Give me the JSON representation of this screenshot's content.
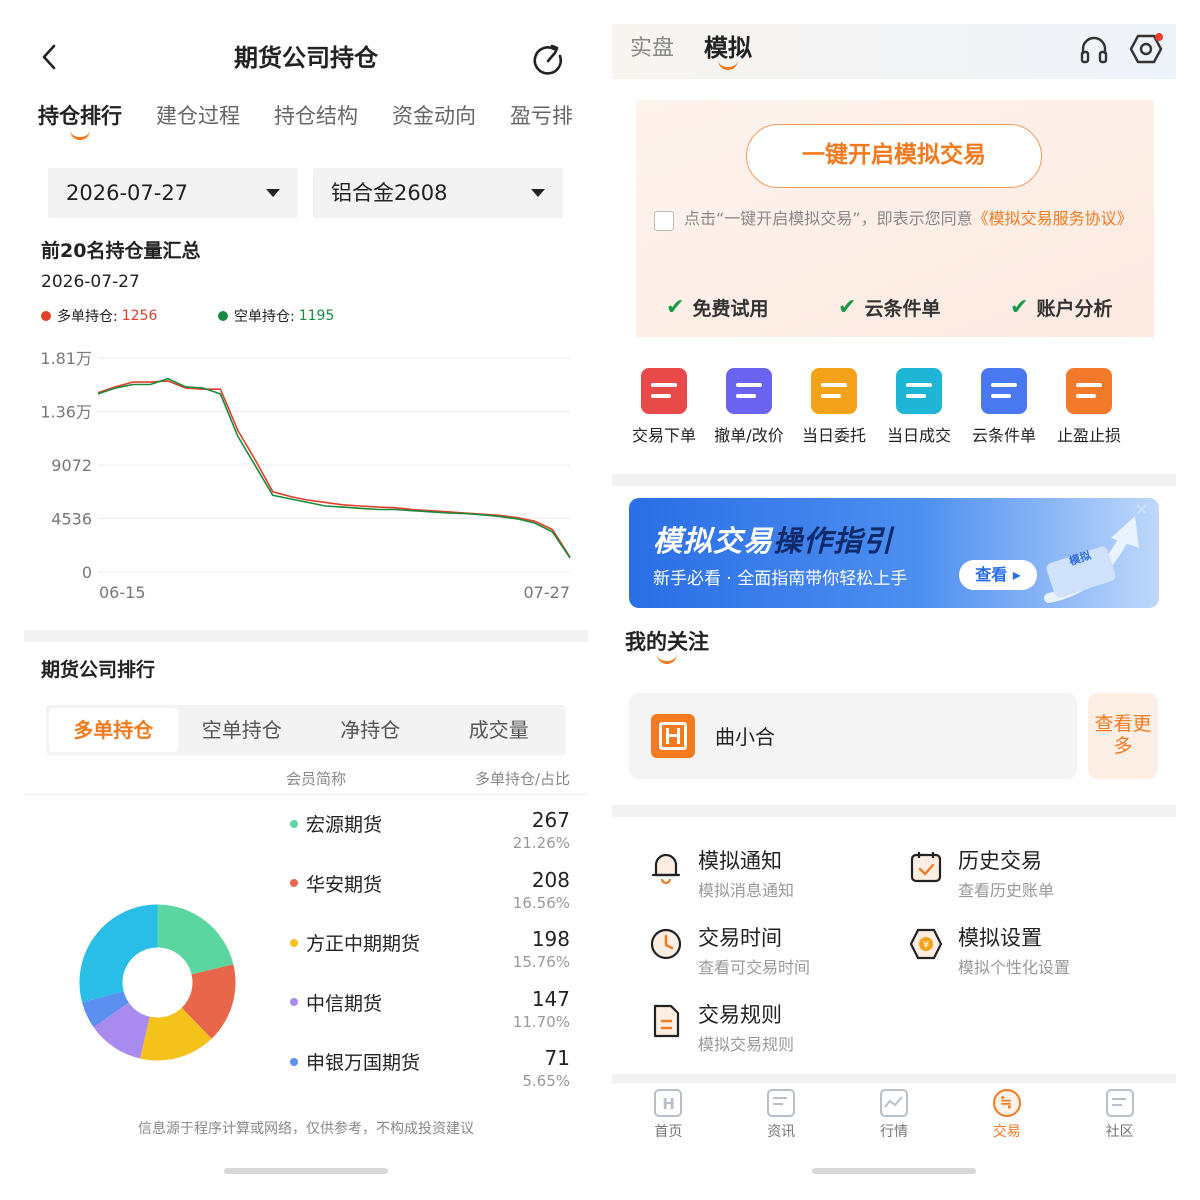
{
  "left": {
    "title": "期货公司持仓",
    "tabs": [
      "持仓排行",
      "建仓过程",
      "持仓结构",
      "资金动向",
      "盈亏排"
    ],
    "date_select": "2026-07-27",
    "contract_select": "铝合金2608",
    "summary": {
      "title": "前20名持仓量汇总",
      "date": "2026-07-27",
      "long_label": "多单持仓:",
      "long_value": "1256",
      "short_label": "空单持仓:",
      "short_value": "1195"
    },
    "chart_data": {
      "type": "line",
      "x_start": "06-15",
      "x_end": "07-27",
      "y_ticks": [
        "1.81万",
        "1.36万",
        "9072",
        "4536",
        "0"
      ],
      "ylim": [
        0,
        18144
      ],
      "grid": true,
      "colors": {
        "long": "#e0402a",
        "short": "#1a8a3e"
      },
      "series": [
        {
          "name": "多单持仓",
          "values": [
            15200,
            15700,
            16100,
            16100,
            16200,
            15600,
            15500,
            15500,
            12000,
            9500,
            6800,
            6400,
            6100,
            5900,
            5700,
            5600,
            5500,
            5450,
            5300,
            5200,
            5100,
            5000,
            4900,
            4800,
            4600,
            4300,
            3600,
            1256
          ]
        },
        {
          "name": "空单持仓",
          "values": [
            15100,
            15600,
            15900,
            15900,
            16400,
            15700,
            15600,
            15100,
            11500,
            9000,
            6500,
            6200,
            5900,
            5600,
            5500,
            5400,
            5300,
            5300,
            5200,
            5100,
            5000,
            4950,
            4850,
            4700,
            4500,
            4150,
            3400,
            1195
          ]
        }
      ]
    },
    "ranking": {
      "title": "期货公司排行",
      "segments": [
        "多单持仓",
        "空单持仓",
        "净持仓",
        "成交量"
      ],
      "col_name": "会员简称",
      "col_value": "多单持仓/占比",
      "rows": [
        {
          "name": "宏源期货",
          "value": "267",
          "pct": "21.26%",
          "color": "#5cd6a0"
        },
        {
          "name": "华安期货",
          "value": "208",
          "pct": "16.56%",
          "color": "#e8674a"
        },
        {
          "name": "方正中期期货",
          "value": "198",
          "pct": "15.76%",
          "color": "#f5c21b"
        },
        {
          "name": "中信期货",
          "value": "147",
          "pct": "11.70%",
          "color": "#a98bf0"
        },
        {
          "name": "申银万国期货",
          "value": "71",
          "pct": "5.65%",
          "color": "#5b8ff0"
        }
      ],
      "donut": [
        {
          "value": 21.26,
          "color": "#5cd6a0"
        },
        {
          "value": 16.56,
          "color": "#e8674a"
        },
        {
          "value": 15.76,
          "color": "#f5c21b"
        },
        {
          "value": 11.7,
          "color": "#a98bf0"
        },
        {
          "value": 5.65,
          "color": "#5b8ff0"
        },
        {
          "value": 29.07,
          "color": "#29bde8"
        }
      ]
    },
    "disclaimer": "信息源于程序计算或网络，仅供参考，不构成投资建议"
  },
  "right": {
    "tabs": [
      "实盘",
      "模拟"
    ],
    "promo": {
      "button": "一键开启模拟交易",
      "agree_text": "点击“一键开启模拟交易”，即表示您同意",
      "agree_link": "《模拟交易服务协议》",
      "features": [
        "免费试用",
        "云条件单",
        "账户分析"
      ]
    },
    "tools": [
      {
        "label": "交易下单",
        "icon": "trade-order-icon",
        "color": "#e84a4a"
      },
      {
        "label": "撤单/改价",
        "icon": "cancel-order-icon",
        "color": "#6a63f0"
      },
      {
        "label": "当日委托",
        "icon": "daily-order-icon",
        "color": "#f5a21b"
      },
      {
        "label": "当日成交",
        "icon": "daily-deal-icon",
        "color": "#1fb6d6"
      },
      {
        "label": "云条件单",
        "icon": "cloud-order-icon",
        "color": "#4a78f0"
      },
      {
        "label": "止盈止损",
        "icon": "stop-profit-loss-icon",
        "color": "#f27a2a"
      }
    ],
    "banner": {
      "title_a": "模拟交易",
      "title_b": "操作指引",
      "subtitle": "新手必看 · 全面指南带你轻松上手",
      "button": "查看 ▸",
      "badge": "模拟"
    },
    "watch": {
      "title": "我的关注",
      "name": "曲小合",
      "more": "查看更多"
    },
    "menu": [
      {
        "title": "模拟通知",
        "sub": "模拟消息通知"
      },
      {
        "title": "历史交易",
        "sub": "查看历史账单"
      },
      {
        "title": "交易时间",
        "sub": "查看可交易时间"
      },
      {
        "title": "模拟设置",
        "sub": "模拟个性化设置"
      },
      {
        "title": "交易规则",
        "sub": "模拟交易规则"
      }
    ],
    "nav": [
      "首页",
      "资讯",
      "行情",
      "交易",
      "社区"
    ]
  }
}
